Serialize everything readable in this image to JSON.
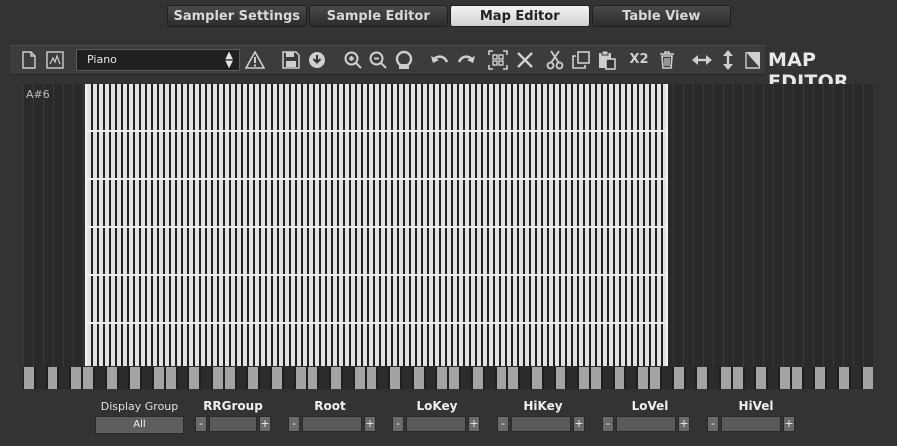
{
  "tabs": [
    {
      "label": "Sampler Settings",
      "active": false
    },
    {
      "label": "Sample Editor",
      "active": false
    },
    {
      "label": "Map Editor",
      "active": true
    },
    {
      "label": "Table View",
      "active": false
    }
  ],
  "toolbar": {
    "preset_value": "Piano",
    "x2_label": "X2",
    "icons": [
      "new-file-icon",
      "edit-script-icon",
      "warning-icon",
      "save-icon",
      "download-icon",
      "zoom-in-icon",
      "zoom-out-icon",
      "zoom-reset-icon",
      "undo-icon",
      "redo-icon",
      "select-all-icon",
      "close-icon",
      "cut-icon",
      "copy-icon",
      "paste-icon",
      "x2-icon",
      "delete-icon",
      "expand-horizontal-icon",
      "expand-vertical-icon",
      "fill-icon"
    ]
  },
  "header": {
    "title": "MAP EDITOR"
  },
  "map": {
    "top_note_label": "A#6"
  },
  "bottom": {
    "display_group_label": "Display Group",
    "display_group_value": "All",
    "controls": [
      {
        "label": "RRGroup"
      },
      {
        "label": "Root"
      },
      {
        "label": "LoKey"
      },
      {
        "label": "HiKey"
      },
      {
        "label": "LoVel"
      },
      {
        "label": "HiVel"
      }
    ],
    "minus_label": "-",
    "plus_label": "+"
  },
  "colors": {
    "background": "#333333",
    "active_tab": "#e8e8e8",
    "zone_line": "#e8e8e8"
  }
}
